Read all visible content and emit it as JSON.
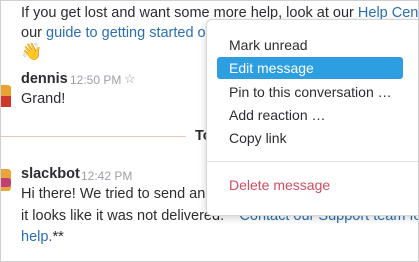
{
  "messages": {
    "intro_line1_prefix": "If you get lost and want some more help, look at our ",
    "intro_line1_link": "Help Cente",
    "intro_line2_prefix": "our ",
    "intro_line2_link": "guide to getting started or",
    "intro_emoji": "👋",
    "dennis": {
      "name": "dennis",
      "time": "12:50 PM",
      "star": "☆",
      "text": "Grand!"
    },
    "day_divider_partial": "To",
    "slackbot": {
      "name": "slackbot",
      "time": "12:42 PM",
      "line1": "Hi there! We tried to send an e",
      "line2_prefix": "it looks like it was not delivered. **",
      "line2_link": "Contact our Support team for",
      "line3_link": "help.",
      "line3_suffix": "**"
    }
  },
  "context_menu": {
    "items": [
      "Mark unread",
      "Edit message",
      "Pin to this conversation …",
      "Add reaction …",
      "Copy link"
    ],
    "selected_index": 1,
    "danger_item": "Delete message"
  },
  "colors": {
    "link": "#2a6fb1",
    "menu_selected": "#2d9ee0",
    "danger": "#cf4d5f"
  }
}
